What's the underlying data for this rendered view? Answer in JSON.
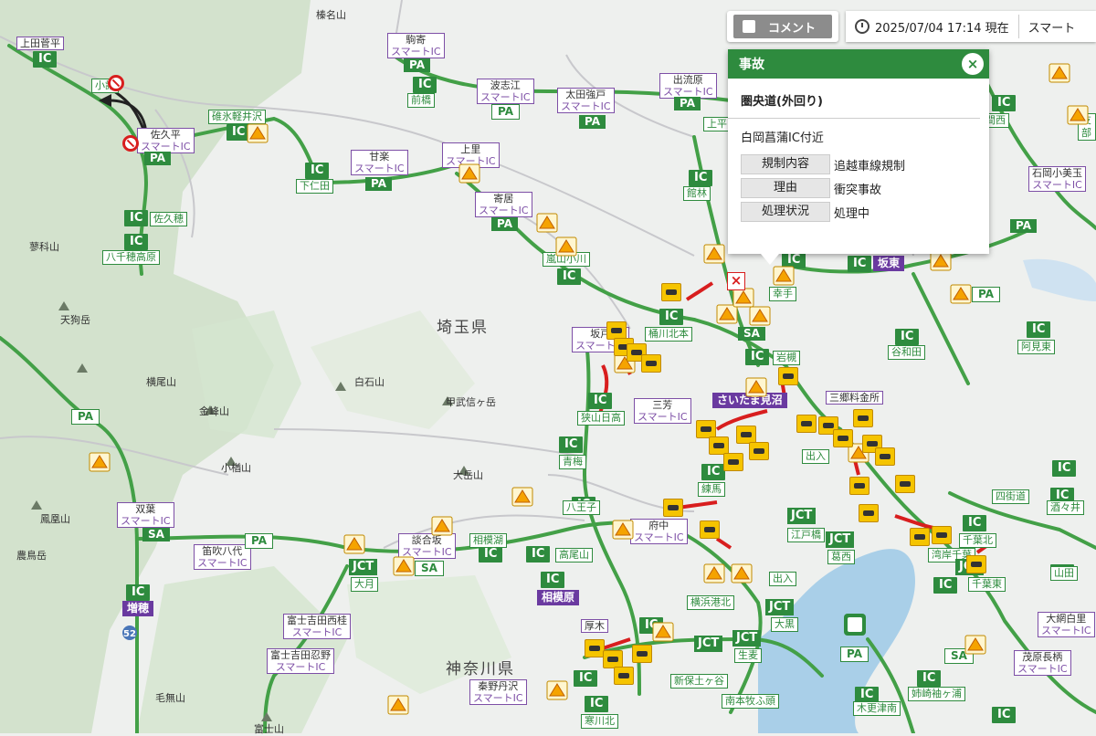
{
  "comment_button": {
    "label": "コメント"
  },
  "timebar": {
    "datetime": "2025/07/04 17:14 現在",
    "smart_label": "スマート"
  },
  "popup": {
    "title": "事故",
    "close_glyph": "×",
    "road": "圏央道(外回り)",
    "place": "白岡菖蒲IC付近",
    "rows": [
      {
        "key": "規制内容",
        "value": "追越車線規制"
      },
      {
        "key": "理由",
        "value": "衝突事故"
      },
      {
        "key": "処理状況",
        "value": "処理中"
      }
    ]
  },
  "map": {
    "prefectures": [
      "埼玉県",
      "神奈川県"
    ],
    "mountains": [
      "榛名山",
      "蓼科山",
      "天狗岳",
      "横尾山",
      "白石山",
      "甲武信ヶ岳",
      "金峰山",
      "小楢山",
      "大岳山",
      "鳳凰山",
      "農鳥岳",
      "毛無山",
      "富士山"
    ],
    "ic_labels": [
      "IC",
      "IC",
      "IC",
      "IC",
      "IC",
      "IC",
      "IC",
      "IC",
      "IC",
      "IC",
      "IC",
      "IC",
      "IC",
      "IC",
      "IC",
      "IC",
      "IC",
      "IC",
      "IC",
      "IC",
      "IC",
      "IC",
      "IC",
      "IC",
      "IC",
      "IC",
      "IC",
      "IC",
      "IC",
      "IC",
      "IC",
      "IC",
      "IC",
      "IC"
    ],
    "smart_ics": [
      {
        "name": "上田菅平",
        "type": ""
      },
      {
        "name": "駒寄",
        "type": "スマートIC"
      },
      {
        "name": "波志江",
        "type": "スマートIC"
      },
      {
        "name": "太田強戸",
        "type": "スマートIC"
      },
      {
        "name": "出流原",
        "type": "スマートIC"
      },
      {
        "name": "佐久平",
        "type": "スマートIC"
      },
      {
        "name": "甘楽",
        "type": "スマートIC"
      },
      {
        "name": "上里",
        "type": "スマートIC"
      },
      {
        "name": "寄居",
        "type": "スマートIC"
      },
      {
        "name": "坂戸",
        "type": "スマートIC"
      },
      {
        "name": "三芳",
        "type": "スマートIC"
      },
      {
        "name": "石岡小美玉",
        "type": "スマートIC"
      },
      {
        "name": "双葉",
        "type": "スマートIC"
      },
      {
        "name": "笛吹八代",
        "type": "スマートIC"
      },
      {
        "name": "談合坂",
        "type": "スマートIC"
      },
      {
        "name": "府中",
        "type": "スマートIC"
      },
      {
        "name": "富士吉田西桂",
        "type": "スマートIC"
      },
      {
        "name": "富士吉田忍野",
        "type": "スマートIC"
      },
      {
        "name": "秦野丹沢",
        "type": "スマートIC"
      },
      {
        "name": "大網白里",
        "type": "スマートIC"
      },
      {
        "name": "茂原長柄",
        "type": "スマートIC"
      }
    ],
    "place_names": [
      "小諸",
      "碓氷軽井沢",
      "下仁田",
      "佐久穂",
      "八千穂高原",
      "前橋",
      "館林",
      "坂東",
      "幸手",
      "桶川北本",
      "嵐山小川",
      "狭山日高",
      "青梅",
      "練馬",
      "岩槻",
      "谷和田",
      "阿見東",
      "三郷料金所",
      "加須",
      "川越",
      "八王子",
      "相模湖",
      "高尾山",
      "相模原",
      "厚木",
      "寒川北",
      "新保土ヶ谷",
      "生麦",
      "大黒",
      "南本牧ふ頭",
      "江戸橋",
      "葛西",
      "千葉北",
      "千葉東",
      "湾岸千葉",
      "四街道",
      "酒々井",
      "山田",
      "姉崎袖ヶ浦",
      "木更津南",
      "大月",
      "増穂",
      "さいたま見沼",
      "横浜港北",
      "出入",
      "大師",
      "上平",
      "友部",
      "笠間西"
    ],
    "route_number": "52",
    "pa_labels": [
      "PA",
      "PA",
      "PA",
      "PA",
      "PA",
      "PA",
      "PA",
      "PA",
      "PA",
      "SA",
      "SA",
      "SA",
      "PA",
      "PA",
      "SA"
    ],
    "accent_green": "#2e8b3e",
    "accent_purple": "#7d4fa6",
    "incident_red": "#d81e1e"
  }
}
